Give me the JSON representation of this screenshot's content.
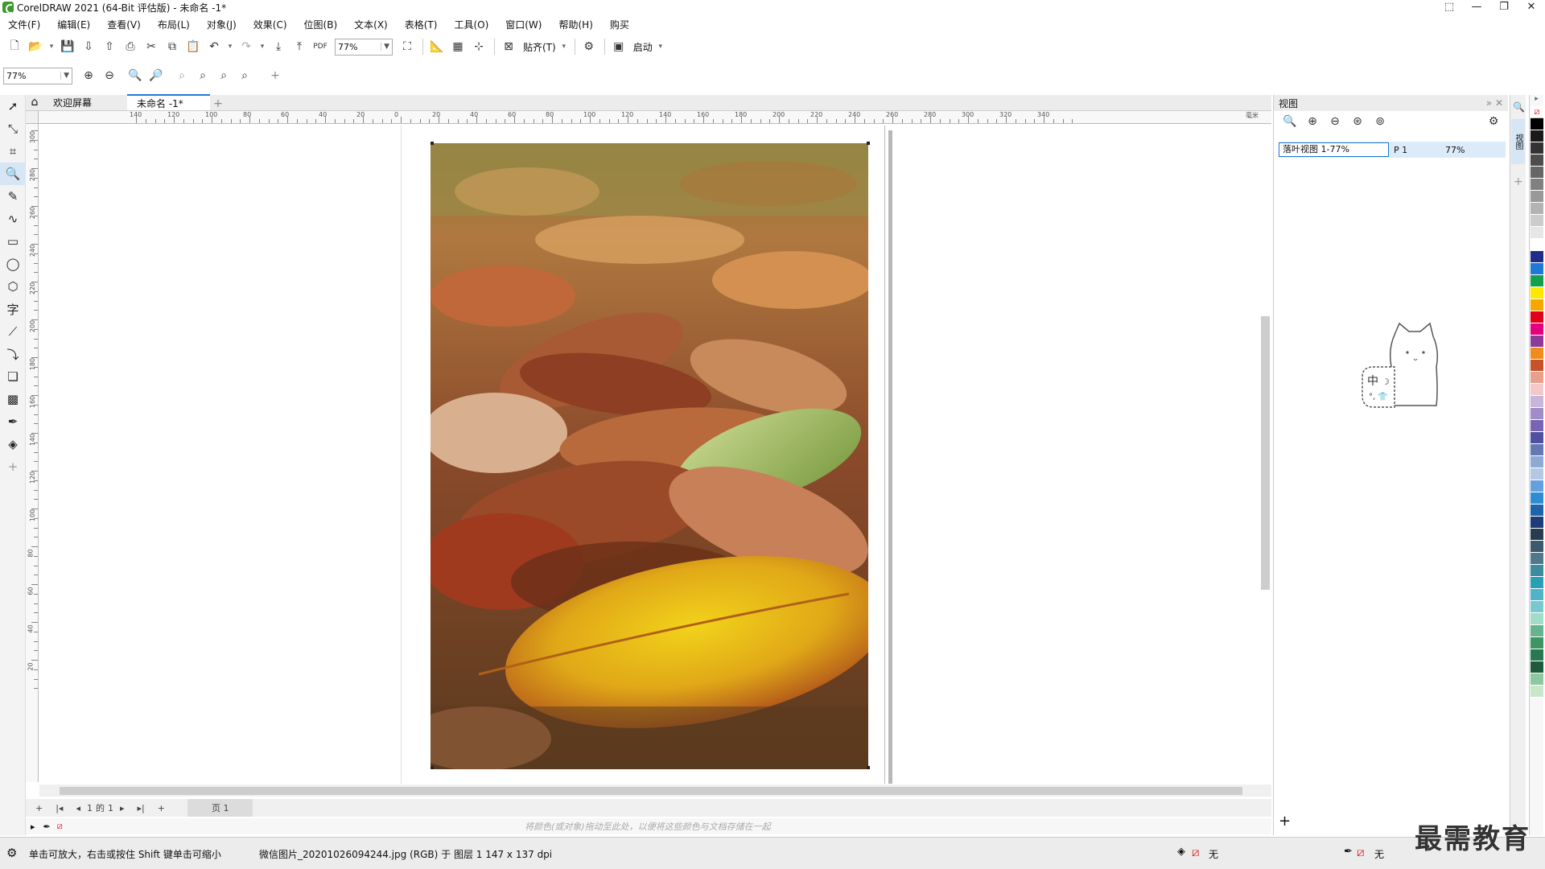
{
  "window": {
    "title": "CorelDRAW 2021 (64-Bit 评估版) - 未命名 -1*",
    "controls": [
      "⬚",
      "—",
      "❐",
      "✕"
    ]
  },
  "menu": [
    "文件(F)",
    "编辑(E)",
    "查看(V)",
    "布局(L)",
    "对象(J)",
    "效果(C)",
    "位图(B)",
    "文本(X)",
    "表格(T)",
    "工具(O)",
    "窗口(W)",
    "帮助(H)",
    "购买"
  ],
  "toolbar": {
    "zoom_value": "77%",
    "snap_label": "贴齐(T)",
    "launch_label": "启动"
  },
  "zoombar": {
    "zoom_value": "77%"
  },
  "tabs": {
    "welcome": "欢迎屏幕",
    "document": "未命名 -1*"
  },
  "ruler": {
    "h_labels": [
      "140",
      "120",
      "100",
      "80",
      "60",
      "40",
      "20",
      "0",
      "20",
      "40",
      "60",
      "80",
      "100",
      "120",
      "140",
      "160",
      "180",
      "200",
      "220",
      "240",
      "260",
      "280",
      "300",
      "320",
      "340"
    ],
    "unit": "毫米",
    "v_labels": [
      "300",
      "280",
      "260",
      "240",
      "220",
      "200",
      "180",
      "160",
      "140",
      "120",
      "100",
      "80",
      "60",
      "40",
      "20"
    ]
  },
  "pagenav": {
    "current": "1",
    "of": "的",
    "total": "1",
    "page_tab": "页 1"
  },
  "palette_hint": "将颜色(或对象)拖动至此处，以便将这些颜色与文档存储在一起",
  "status": {
    "hint": "单击可放大，右击或按住 Shift 键单击可缩小",
    "object_info": "微信图片_20201026094244.jpg (RGB) 于 图层 1 147 x 137 dpi",
    "fill_label": "无",
    "outline_label": "无"
  },
  "docker": {
    "title": "视图",
    "view_name": "落叶视图 1-77%",
    "view_page": "P 1",
    "view_zoom": "77%",
    "side_tab": "视图"
  },
  "palette_colors": [
    "#ffffff",
    "#000000",
    "#1a1a1a",
    "#333333",
    "#4d4d4d",
    "#666666",
    "#808080",
    "#999999",
    "#b3b3b3",
    "#cccccc",
    "#e6e6e6",
    "#ffffff",
    "#1f2c8a",
    "#1e78d6",
    "#14a04a",
    "#ffe800",
    "#f7a800",
    "#e3001b",
    "#e4007f",
    "#8c3c96",
    "#f08c1e",
    "#c8502a",
    "#e8a08c",
    "#f4c8c8",
    "#c8b4dc",
    "#a08cc8",
    "#7864b4",
    "#5050a0",
    "#6478b4",
    "#8caad2",
    "#b4c8e6",
    "#64a0dc",
    "#2d8cd2",
    "#1e64aa",
    "#1e3c78",
    "#283c50",
    "#3c5a6e",
    "#50788c",
    "#3c8ca0",
    "#28a0b4",
    "#50b4c8",
    "#78c8d2",
    "#a0dcc8",
    "#64b48c",
    "#3c9664",
    "#287850",
    "#1e5a3c",
    "#8cc8a0",
    "#c8e6c8"
  ],
  "watermark": "最需教育"
}
